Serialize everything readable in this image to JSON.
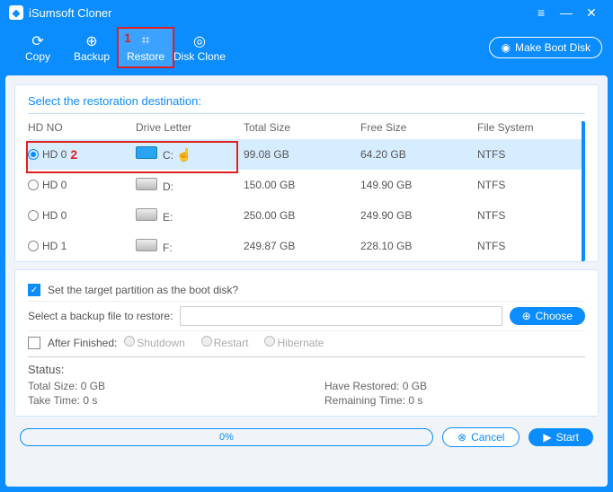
{
  "titlebar": {
    "app_name": "iSumsoft Cloner"
  },
  "toolbar": {
    "copy": "Copy",
    "backup": "Backup",
    "restore": "Restore",
    "disk_clone": "Disk Clone",
    "make_boot_disk": "Make Boot Disk"
  },
  "annotations": {
    "num1": "1",
    "num2": "2"
  },
  "destination": {
    "title": "Select the restoration destination:",
    "columns": {
      "hdno": "HD NO",
      "drive": "Drive Letter",
      "total": "Total Size",
      "free": "Free Size",
      "fs": "File System"
    },
    "rows": [
      {
        "hdno": "HD 0",
        "letter": "C:",
        "total": "99.08 GB",
        "free": "64.20 GB",
        "fs": "NTFS",
        "selected": true,
        "win": true
      },
      {
        "hdno": "HD 0",
        "letter": "D:",
        "total": "150.00 GB",
        "free": "149.90 GB",
        "fs": "NTFS",
        "selected": false,
        "win": false
      },
      {
        "hdno": "HD 0",
        "letter": "E:",
        "total": "250.00 GB",
        "free": "249.90 GB",
        "fs": "NTFS",
        "selected": false,
        "win": false
      },
      {
        "hdno": "HD 1",
        "letter": "F:",
        "total": "249.87 GB",
        "free": "228.10 GB",
        "fs": "NTFS",
        "selected": false,
        "win": false
      }
    ]
  },
  "options": {
    "boot_disk_label": "Set the target partition as the boot disk?",
    "select_backup_label": "Select a backup file to restore:",
    "choose": "Choose",
    "after_finished_label": "After Finished:",
    "shutdown": "Shutdown",
    "restart": "Restart",
    "hibernate": "Hibernate"
  },
  "status": {
    "label": "Status:",
    "total_size": "Total Size: 0 GB",
    "have_restored": "Have Restored: 0 GB",
    "take_time": "Take Time: 0 s",
    "remaining_time": "Remaining Time: 0 s"
  },
  "footer": {
    "progress": "0%",
    "cancel": "Cancel",
    "start": "Start"
  }
}
